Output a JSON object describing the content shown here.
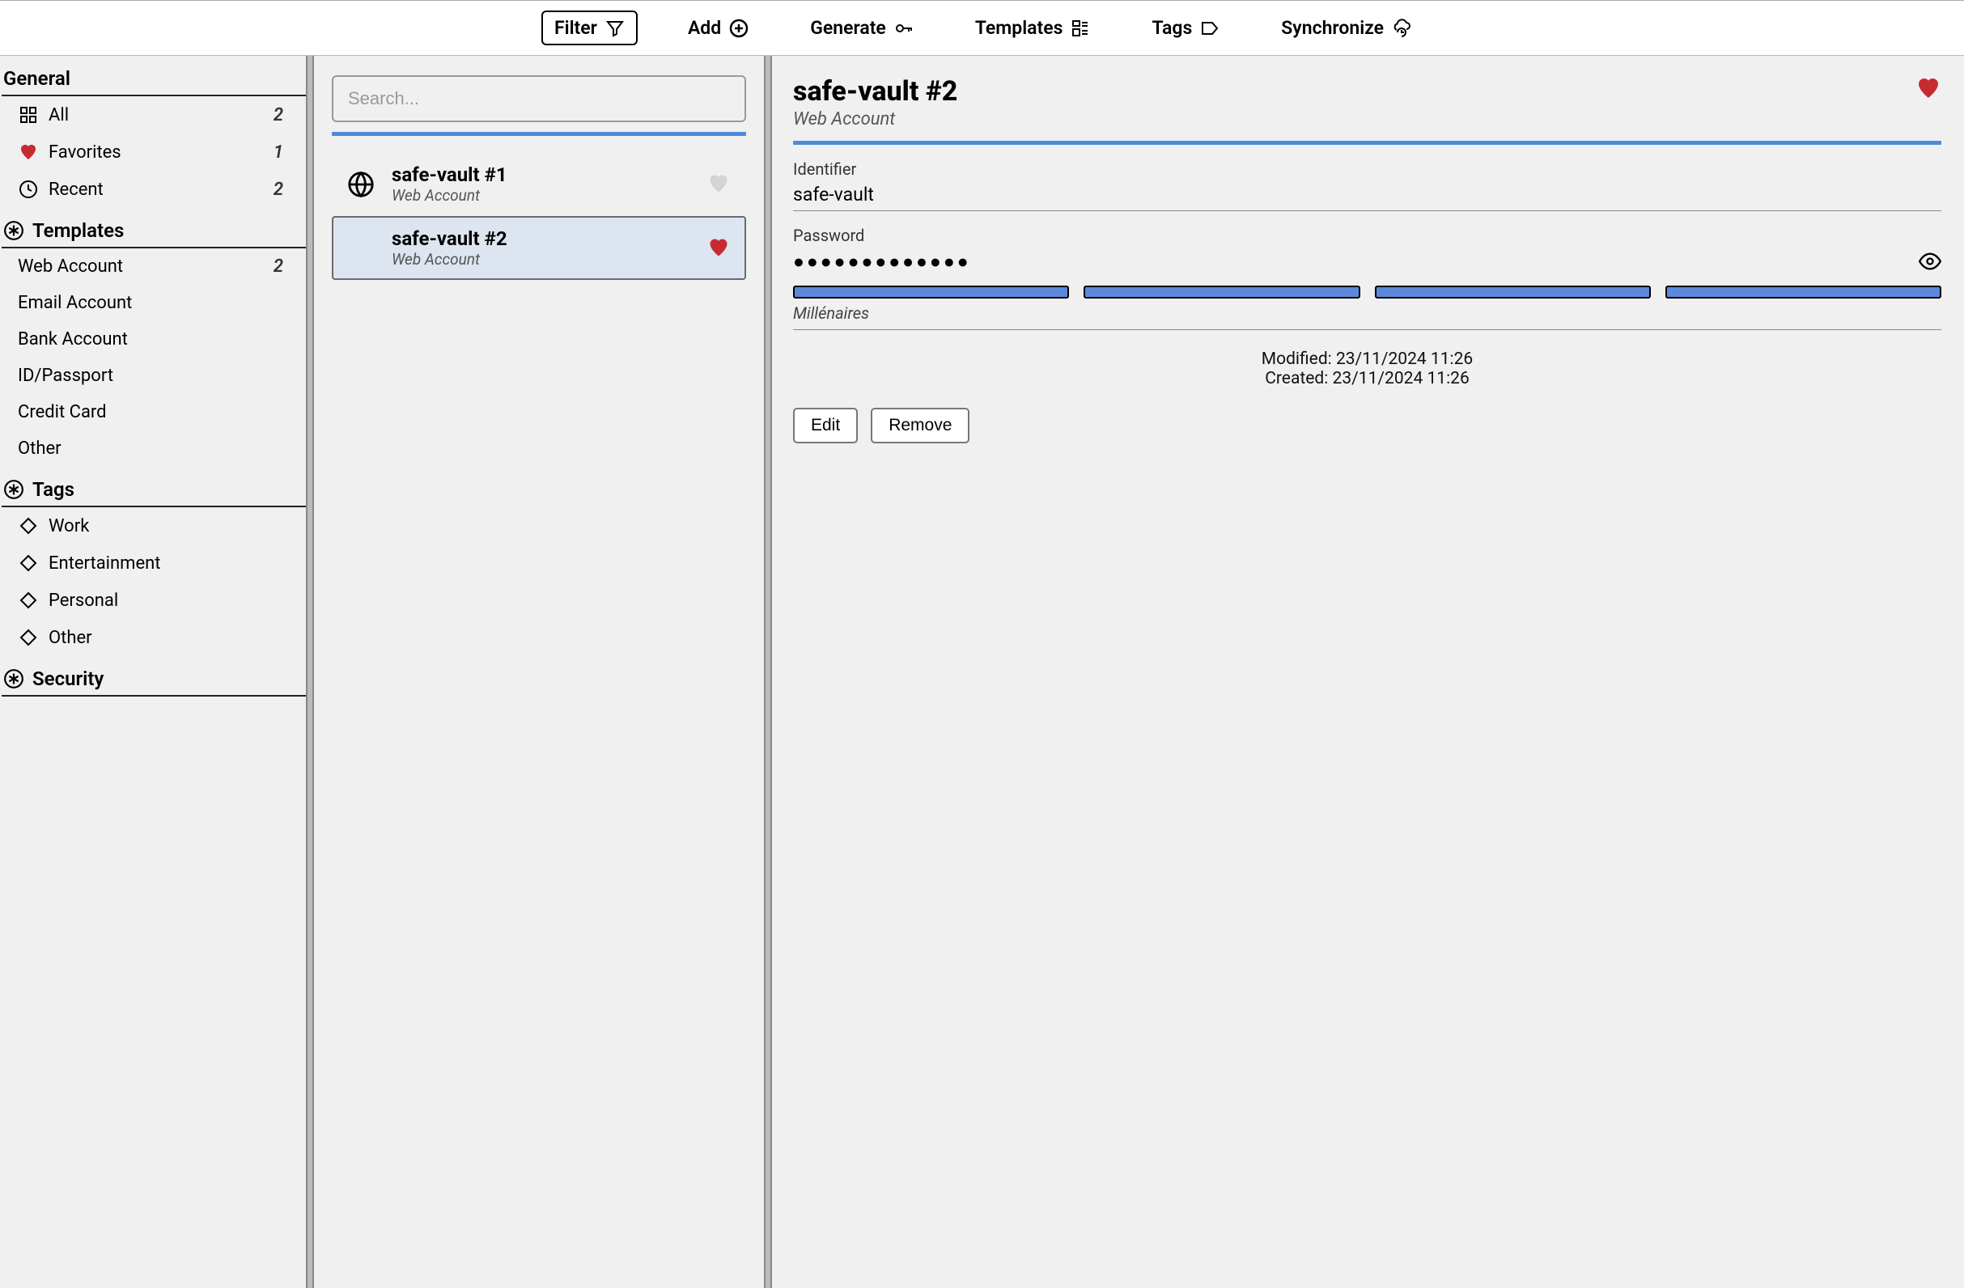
{
  "toolbar": {
    "filter": "Filter",
    "add": "Add",
    "generate": "Generate",
    "templates": "Templates",
    "tags": "Tags",
    "synchronize": "Synchronize"
  },
  "sidebar": {
    "sections": {
      "general": {
        "title": "General",
        "items": [
          {
            "label": "All",
            "count": "2"
          },
          {
            "label": "Favorites",
            "count": "1"
          },
          {
            "label": "Recent",
            "count": "2"
          }
        ]
      },
      "templates": {
        "title": "Templates",
        "items": [
          {
            "label": "Web Account",
            "count": "2"
          },
          {
            "label": "Email Account",
            "count": ""
          },
          {
            "label": "Bank Account",
            "count": ""
          },
          {
            "label": "ID/Passport",
            "count": ""
          },
          {
            "label": "Credit Card",
            "count": ""
          },
          {
            "label": "Other",
            "count": ""
          }
        ]
      },
      "tags": {
        "title": "Tags",
        "items": [
          {
            "label": "Work"
          },
          {
            "label": "Entertainment"
          },
          {
            "label": "Personal"
          },
          {
            "label": "Other"
          }
        ]
      },
      "security": {
        "title": "Security"
      }
    }
  },
  "list": {
    "search_placeholder": "Search...",
    "items": [
      {
        "title": "safe-vault #1",
        "subtitle": "Web Account",
        "favorite": false
      },
      {
        "title": "safe-vault #2",
        "subtitle": "Web Account",
        "favorite": true
      }
    ]
  },
  "detail": {
    "title": "safe-vault #2",
    "subtitle": "Web Account",
    "identifier_label": "Identifier",
    "identifier_value": "safe-vault",
    "password_label": "Password",
    "password_dots": "●●●●●●●●●●●●●",
    "strength_label": "Millénaires",
    "modified_line": "Modified: 23/11/2024 11:26",
    "created_line": "Created: 23/11/2024 11:26",
    "edit_button": "Edit",
    "remove_button": "Remove"
  }
}
